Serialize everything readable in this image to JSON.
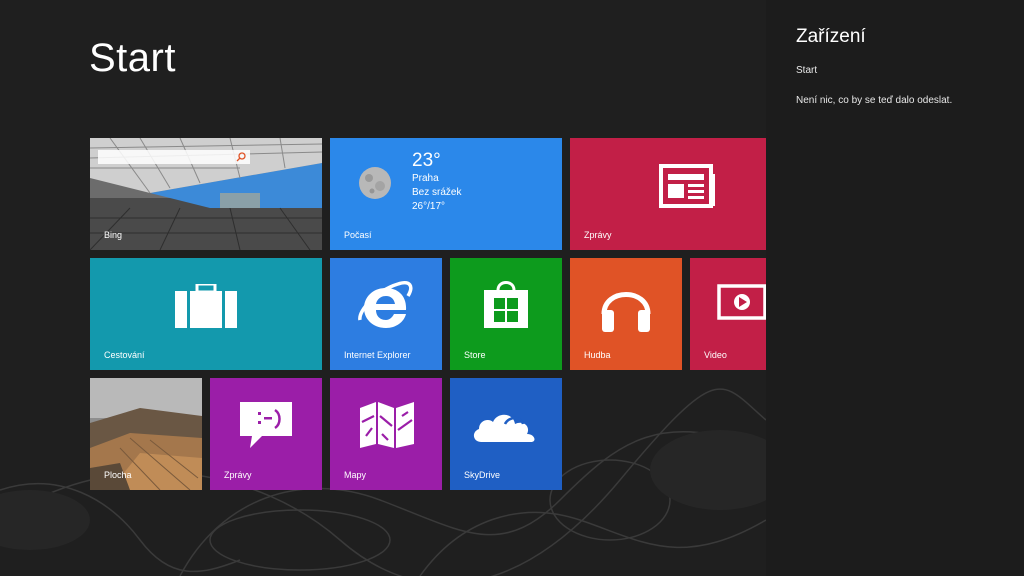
{
  "start": {
    "title": "Start",
    "tiles": [
      {
        "id": "bing",
        "label": "Bing",
        "color": "#5a5a5a"
      },
      {
        "id": "weather",
        "label": "Počasí",
        "color": "#2b88ea",
        "temp": "23°",
        "city": "Praha",
        "condition": "Bez srážek",
        "range": "26°/17°"
      },
      {
        "id": "news",
        "label": "Zprávy",
        "color": "#c21f47"
      },
      {
        "id": "travel",
        "label": "Cestování",
        "color": "#1399ad"
      },
      {
        "id": "ie",
        "label": "Internet Explorer",
        "color": "#2d7de1"
      },
      {
        "id": "store",
        "label": "Store",
        "color": "#0d9b1d"
      },
      {
        "id": "music",
        "label": "Hudba",
        "color": "#e05326"
      },
      {
        "id": "video",
        "label": "Video",
        "color": "#c21f47"
      },
      {
        "id": "desktop",
        "label": "Plocha",
        "color": "#6b5a48"
      },
      {
        "id": "messaging",
        "label": "Zprávy",
        "color": "#9b1ea8"
      },
      {
        "id": "maps",
        "label": "Mapy",
        "color": "#9b1ea8"
      },
      {
        "id": "skydrive",
        "label": "SkyDrive",
        "color": "#1f5fc4"
      }
    ]
  },
  "charm": {
    "title": "Zařízení",
    "subtitle": "Start",
    "message": "Není nic, co by se teď dalo odeslat."
  },
  "icons": {
    "weather": "moon-icon",
    "news": "newspaper-icon",
    "travel": "suitcase-icon",
    "ie": "internet-explorer-icon",
    "store": "store-bag-icon",
    "music": "headphones-icon",
    "video": "video-play-icon",
    "messaging": "emoticon-speech-bubble-icon",
    "maps": "folded-map-icon",
    "skydrive": "cloud-icon",
    "bing": "search-icon"
  }
}
